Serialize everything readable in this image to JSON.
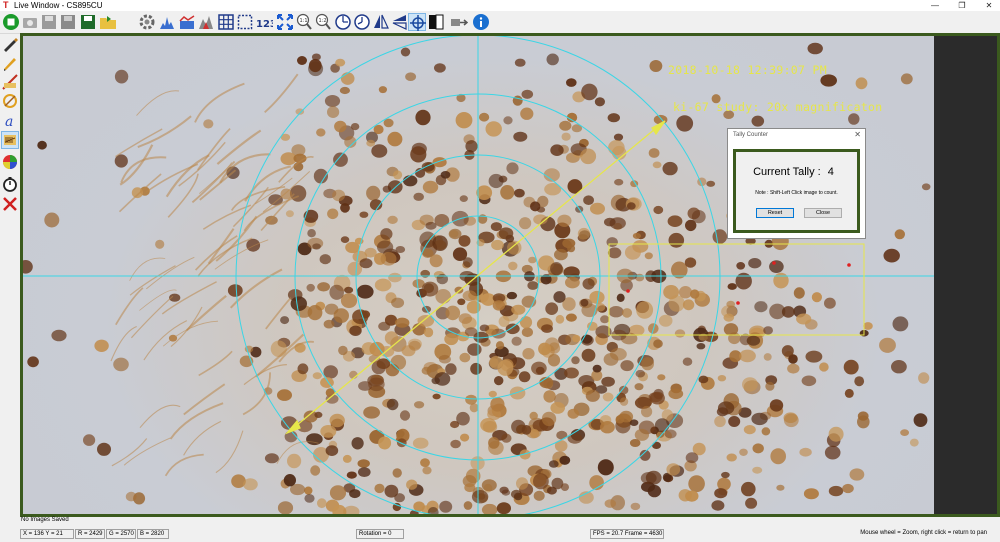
{
  "window": {
    "title": "Live Window - CS895CU",
    "logo": "T",
    "minimize": "—",
    "maximize": "❐",
    "close": "✕"
  },
  "toolbar": {
    "buttons": [
      {
        "name": "start-stop-icon"
      },
      {
        "name": "camera-icon"
      },
      {
        "name": "save-icon"
      },
      {
        "name": "save-all-icon"
      },
      {
        "name": "save-green-icon"
      },
      {
        "name": "open-folder-icon"
      },
      {
        "name": "settings-gear-icon"
      },
      {
        "name": "histogram-icon"
      },
      {
        "name": "line-profile-icon"
      },
      {
        "name": "color-histogram-icon"
      },
      {
        "name": "grid-icon"
      },
      {
        "name": "select-rect-icon"
      },
      {
        "name": "count-icon"
      },
      {
        "name": "fit-window-icon"
      },
      {
        "name": "zoom-actual-icon"
      },
      {
        "name": "zoom-half-icon"
      },
      {
        "name": "rotate-icon"
      },
      {
        "name": "timer-icon"
      },
      {
        "name": "flip-icon"
      },
      {
        "name": "flip-vertical-icon"
      },
      {
        "name": "crosshair-icon"
      },
      {
        "name": "contrast-icon"
      },
      {
        "name": "export-icon"
      },
      {
        "name": "info-icon"
      }
    ]
  },
  "left_tools": [
    {
      "name": "pen-icon"
    },
    {
      "name": "pencil-icon"
    },
    {
      "name": "ruler-icon"
    },
    {
      "name": "angle-icon"
    },
    {
      "name": "text-icon"
    },
    {
      "name": "tally-counter-icon"
    },
    {
      "name": "color-wheel-icon"
    },
    {
      "name": "stopwatch-icon"
    },
    {
      "name": "delete-icon"
    }
  ],
  "overlay": {
    "timestamp": "2018-10-18 12:39:07 PM",
    "annotation": "ki-67 study: 20x magnificaton"
  },
  "tally_dialog": {
    "title": "Tally Counter",
    "close": "✕",
    "tally_label": "Current Tally :",
    "tally_value": "4",
    "note": "Note : Shift-Left Click image to count.",
    "reset_label": "Reset",
    "close_label": "Close"
  },
  "status": {
    "saved": "No Images Saved",
    "coords": "X = 136  Y = 21",
    "r": "R = 2429",
    "g": "G = 2570",
    "b": "B = 2820",
    "rotation": "Rotation = 0",
    "fps": "FPS = 20.7  Frame = 4630",
    "hint": "Mouse wheel = Zoom, right click = return to pan"
  },
  "colors": {
    "frame": "#3b5a1e",
    "overlay_cyan": "#3ad6e6",
    "overlay_yellow": "#e6e64a",
    "tally_mark": "#e02020",
    "cell_dark": "#6b3a1a",
    "cell_light": "#b5844a"
  }
}
